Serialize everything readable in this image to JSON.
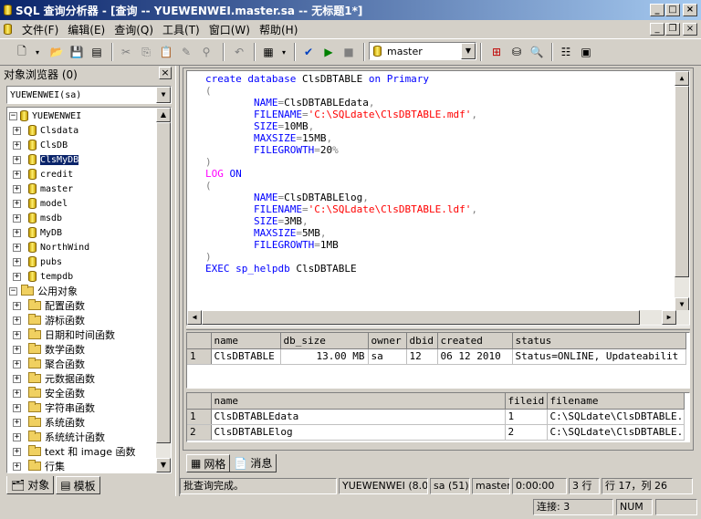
{
  "window": {
    "title": "SQL 查询分析器 - [查询 -- YUEWENWEI.master.sa -- 无标题1*]",
    "controls": [
      "_",
      "□",
      "×"
    ]
  },
  "menu": [
    "文件(F)",
    "编辑(E)",
    "查询(Q)",
    "工具(T)",
    "窗口(W)",
    "帮助(H)"
  ],
  "toolbar": {
    "database": "master"
  },
  "object_browser": {
    "title": "对象浏览器 (0)",
    "server_combo": "YUEWENWEI(sa)",
    "server": "YUEWENWEI",
    "databases": [
      "Clsdata",
      "ClsDB",
      "ClsMyDB",
      "credit",
      "master",
      "model",
      "msdb",
      "MyDB",
      "NorthWind",
      "pubs",
      "tempdb"
    ],
    "selected_database": "ClsMyDB",
    "common_objects": "公用对象",
    "functions": [
      "配置函数",
      "游标函数",
      "日期和时间函数",
      "数学函数",
      "聚合函数",
      "元数据函数",
      "安全函数",
      "字符串函数",
      "系统函数",
      "系统统计函数",
      "text 和 image 函数",
      "行集"
    ],
    "tabs": [
      "对象",
      "模板"
    ]
  },
  "editor": {
    "lines": [
      [
        {
          "t": "create database ",
          "c": "kw"
        },
        {
          "t": "ClsDBTABLE ",
          "c": ""
        },
        {
          "t": "on Primary",
          "c": "kw"
        }
      ],
      [
        {
          "t": "(",
          "c": "gr"
        }
      ],
      [
        {
          "t": "        NAME",
          "c": "kw"
        },
        {
          "t": "=",
          "c": "gr"
        },
        {
          "t": "ClsDBTABLEdata",
          "c": ""
        },
        {
          "t": ",",
          "c": "gr"
        }
      ],
      [
        {
          "t": "        FILENAME",
          "c": "kw"
        },
        {
          "t": "=",
          "c": "gr"
        },
        {
          "t": "'C:\\SQLdate\\ClsDBTABLE.mdf'",
          "c": "st"
        },
        {
          "t": ",",
          "c": "gr"
        }
      ],
      [
        {
          "t": "        SIZE",
          "c": "kw"
        },
        {
          "t": "=",
          "c": "gr"
        },
        {
          "t": "10MB",
          "c": ""
        },
        {
          "t": ",",
          "c": "gr"
        }
      ],
      [
        {
          "t": "        MAXSIZE",
          "c": "kw"
        },
        {
          "t": "=",
          "c": "gr"
        },
        {
          "t": "15MB",
          "c": ""
        },
        {
          "t": ",",
          "c": "gr"
        }
      ],
      [
        {
          "t": "        FILEGROWTH",
          "c": "kw"
        },
        {
          "t": "=",
          "c": "gr"
        },
        {
          "t": "20",
          "c": ""
        },
        {
          "t": "%",
          "c": "gr"
        }
      ],
      [
        {
          "t": ")",
          "c": "gr"
        }
      ],
      [
        {
          "t": "LOG ",
          "c": "mg"
        },
        {
          "t": "ON",
          "c": "kw"
        }
      ],
      [
        {
          "t": "(",
          "c": "gr"
        }
      ],
      [
        {
          "t": "        NAME",
          "c": "kw"
        },
        {
          "t": "=",
          "c": "gr"
        },
        {
          "t": "ClsDBTABLElog",
          "c": ""
        },
        {
          "t": ",",
          "c": "gr"
        }
      ],
      [
        {
          "t": "        FILENAME",
          "c": "kw"
        },
        {
          "t": "=",
          "c": "gr"
        },
        {
          "t": "'C:\\SQLdate\\ClsDBTABLE.ldf'",
          "c": "st"
        },
        {
          "t": ",",
          "c": "gr"
        }
      ],
      [
        {
          "t": "        SIZE",
          "c": "kw"
        },
        {
          "t": "=",
          "c": "gr"
        },
        {
          "t": "3MB",
          "c": ""
        },
        {
          "t": ",",
          "c": "gr"
        }
      ],
      [
        {
          "t": "        MAXSIZE",
          "c": "kw"
        },
        {
          "t": "=",
          "c": "gr"
        },
        {
          "t": "5MB",
          "c": ""
        },
        {
          "t": ",",
          "c": "gr"
        }
      ],
      [
        {
          "t": "        FILEGROWTH",
          "c": "kw"
        },
        {
          "t": "=",
          "c": "gr"
        },
        {
          "t": "1MB",
          "c": ""
        }
      ],
      [
        {
          "t": ")",
          "c": "gr"
        }
      ],
      [
        {
          "t": "EXEC ",
          "c": "kw"
        },
        {
          "t": "sp_helpdb ",
          "c": "kw"
        },
        {
          "t": "ClsDBTABLE",
          "c": ""
        }
      ]
    ]
  },
  "results1": {
    "columns": [
      "name",
      "db_size",
      "owner",
      "dbid",
      "created",
      "status"
    ],
    "rows": [
      [
        "1",
        "ClsDBTABLE",
        "13.00 MB",
        "sa",
        "12",
        "06 12 2010",
        "Status=ONLINE, Updateabilit"
      ]
    ]
  },
  "results2": {
    "columns": [
      "name",
      "fileid",
      "filename"
    ],
    "rows": [
      [
        "1",
        "ClsDBTABLEdata",
        "1",
        "C:\\SQLdate\\ClsDBTABLE."
      ],
      [
        "2",
        "ClsDBTABLElog",
        "2",
        "C:\\SQLdate\\ClsDBTABLE."
      ]
    ]
  },
  "result_tabs": [
    "网格",
    "消息"
  ],
  "status": {
    "message": "批查询完成。",
    "server": "YUEWENWEI (8.0)",
    "user": "sa (51)",
    "database": "master",
    "time": "0:00:00",
    "rows": "3 行",
    "position": "行 17，列 26",
    "connections": "连接: 3",
    "num": "NUM"
  }
}
